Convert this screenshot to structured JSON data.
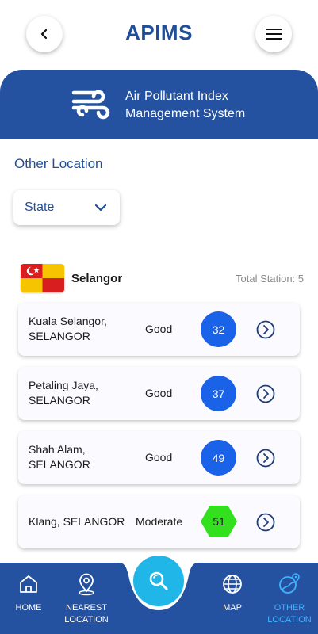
{
  "header": {
    "title": "APIMS",
    "back_icon": "chevron-left-icon",
    "menu_icon": "hamburger-menu-icon"
  },
  "banner": {
    "icon": "wind-icon",
    "line1": "Air Pollutant Index",
    "line2": "Management System"
  },
  "section": {
    "title": "Other Location"
  },
  "filter": {
    "label": "State",
    "icon": "chevron-down-icon"
  },
  "state": {
    "name": "Selangor",
    "flag_icon": "selangor-flag-icon",
    "total_station": "Total Station: 5"
  },
  "stations": [
    {
      "name_line1": "Kuala Selangor,",
      "name_line2": "SELANGOR",
      "status": "Good",
      "value": "32",
      "color": "#1a62e8"
    },
    {
      "name_line1": "Petaling Jaya,",
      "name_line2": "SELANGOR",
      "status": "Good",
      "value": "37",
      "color": "#1a62e8"
    },
    {
      "name_line1": "Shah Alam,",
      "name_line2": "SELANGOR",
      "status": "Good",
      "value": "49",
      "color": "#1a62e8"
    },
    {
      "name": "Klang, SELANGOR",
      "status": "Moderate",
      "value": "51",
      "color": "#33e01e"
    }
  ],
  "nav": {
    "home": "HOME",
    "nearest_line1": "NEAREST",
    "nearest_line2": "LOCATION",
    "map": "MAP",
    "other_line1": "OTHER",
    "other_line2": "LOCATION",
    "search_icon": "search-icon"
  },
  "colors": {
    "brand": "#2552a0",
    "title": "#1f4f99",
    "good": "#1a62e8",
    "moderate": "#33e01e",
    "fab": "#21b6e8",
    "active_nav": "#3fb3ff"
  }
}
